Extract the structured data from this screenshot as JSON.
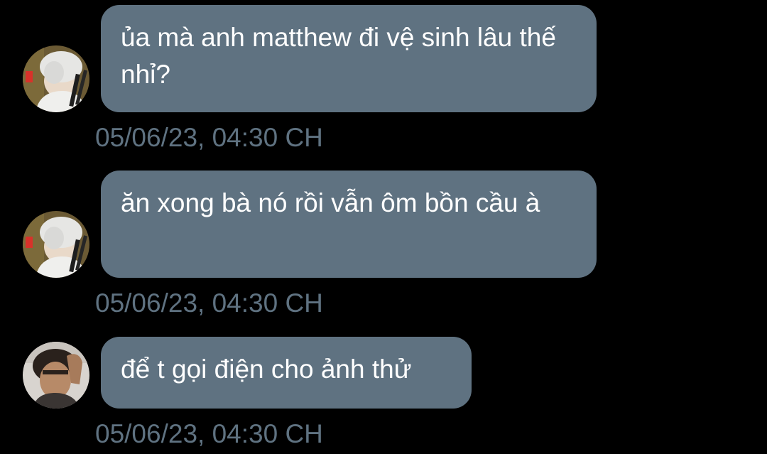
{
  "messages": [
    {
      "text": "ủa mà anh matthew đi vệ sinh lâu thế nhỉ?",
      "timestamp": "05/06/23, 04:30 CH",
      "avatar": "avatar-silver-hair-icon"
    },
    {
      "text": "ăn xong bà nó rồi vẫn ôm bồn cầu à",
      "timestamp": "05/06/23, 04:30 CH",
      "avatar": "avatar-silver-hair-icon"
    },
    {
      "text": "để t gọi điện cho ảnh thử",
      "timestamp": "05/06/23, 04:30 CH",
      "avatar": "avatar-dark-hair-icon"
    }
  ],
  "colors": {
    "background": "#000000",
    "bubble": "#5f7281",
    "bubble_text": "#ffffff",
    "timestamp": "#5f7281"
  }
}
